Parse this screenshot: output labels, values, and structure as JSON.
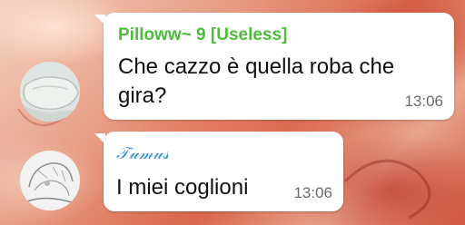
{
  "chat": {
    "messages": [
      {
        "sender": "Pilloww~ 9 [Useless]",
        "sender_color": "#4bbd3a",
        "text_line1": "Che cazzo è quella roba che",
        "text_line2": "gira?",
        "time": "13:06",
        "avatar_icon": "pillow-avatar-icon"
      },
      {
        "sender": "𝒯𝓊𝓂𝓊𝓈",
        "sender_color": "#3a8fd0",
        "text": "I miei coglioni",
        "time": "13:06",
        "avatar_icon": "sketch-avatar-icon"
      }
    ]
  }
}
